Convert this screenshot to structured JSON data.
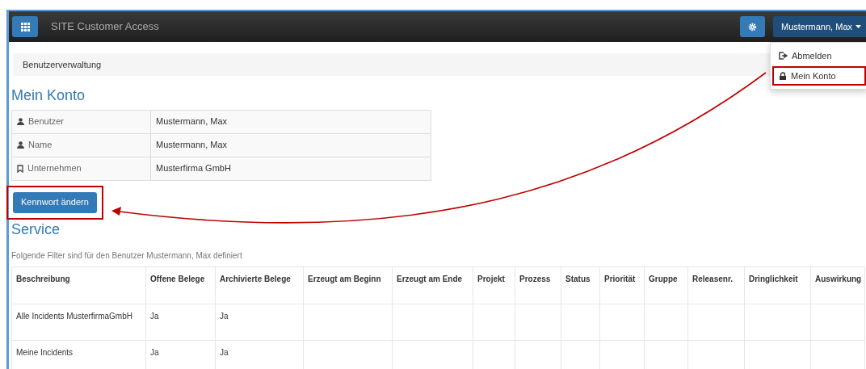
{
  "app": {
    "title": "SITE Customer Access"
  },
  "user_menu": {
    "label": "Mustermann, Max",
    "expanded": true,
    "items": [
      {
        "kind": "logout",
        "label": "Abmelden",
        "highlighted": false
      },
      {
        "kind": "lock",
        "label": "Mein Konto",
        "highlighted": true
      }
    ]
  },
  "breadcrumb": "Benutzerverwaltung",
  "account": {
    "title": "Mein Konto",
    "fields": [
      {
        "kind": "user",
        "label": "Benutzer",
        "value": "Mustermann, Max"
      },
      {
        "kind": "user",
        "label": "Name",
        "value": "Mustermann, Max"
      },
      {
        "kind": "bookmark",
        "label": "Unternehmen",
        "value": "Musterfirma GmbH"
      }
    ],
    "button": {
      "label": "Kennwort ändern",
      "highlighted": true
    }
  },
  "service": {
    "title": "Service",
    "note": "Folgende Filter sind für den Benutzer Mustermann, Max definiert",
    "table": {
      "columns": [
        "Beschreibung",
        "Offene Belege",
        "Archivierte Belege",
        "Erzeugt am Beginn",
        "Erzeugt am Ende",
        "Projekt",
        "Prozess",
        "Status",
        "Priorität",
        "Gruppe",
        "Releasenr.",
        "Dringlichkeit",
        "Auswirkung"
      ],
      "rows": [
        {
          "cells": [
            "Alle Incidents MusterfirmaGmbH",
            "Ja",
            "Ja"
          ]
        },
        {
          "cells": [
            "Meine Incidents",
            "Ja",
            "Ja"
          ]
        }
      ]
    }
  }
}
